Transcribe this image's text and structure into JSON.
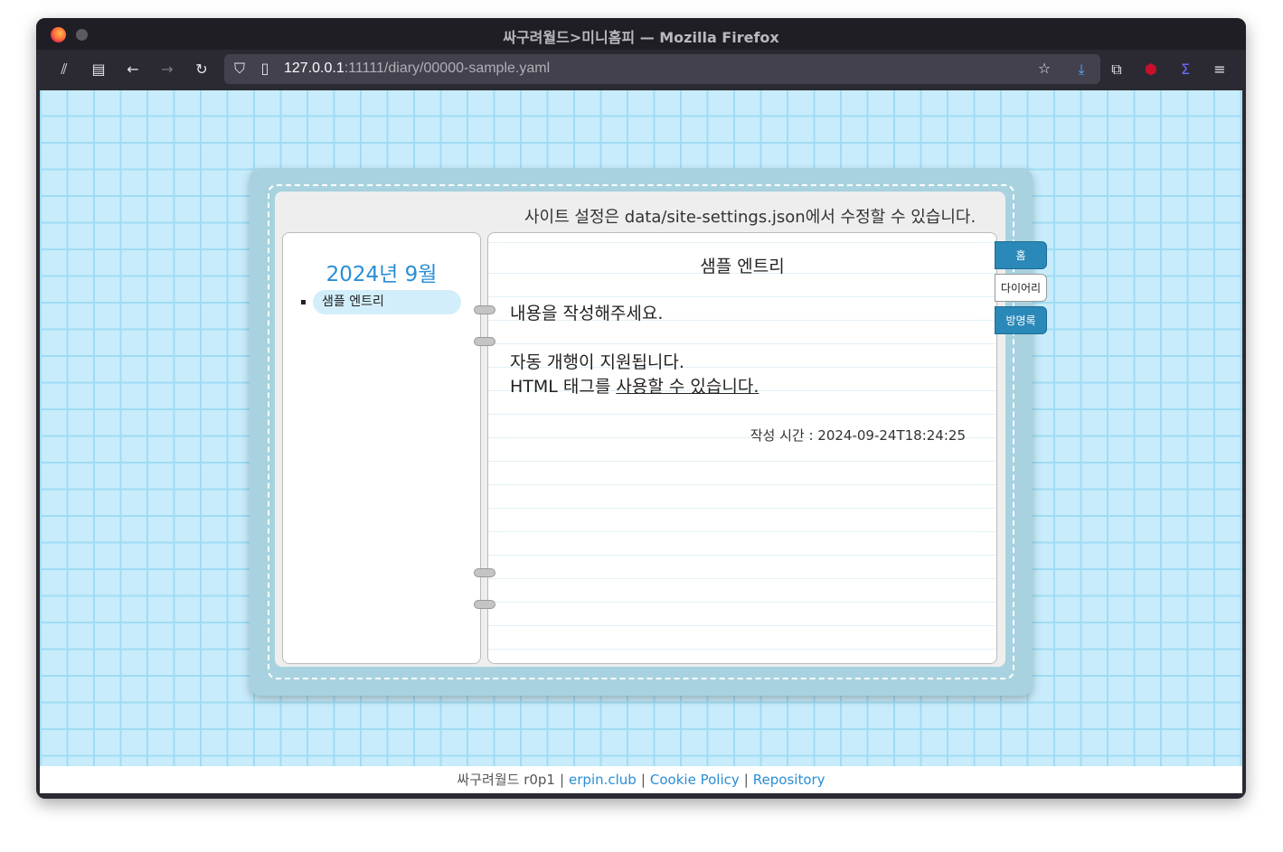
{
  "browser": {
    "window_title": "싸구려월드>미니홈피 — Mozilla Firefox",
    "url_host": "127.0.0.1",
    "url_rest": ":11111/diary/00000-sample.yaml"
  },
  "page": {
    "site_note": "사이트 설정은 data/site-settings.json에서 수정할 수 있습니다.",
    "sidebar": {
      "month": "2024년 9월",
      "entries": [
        "샘플 엔트리"
      ]
    },
    "entry": {
      "title": "샘플 엔트리",
      "line1": "내용을 작성해주세요.",
      "line2": "자동 개행이 지원됩니다.",
      "line3_plain": "HTML 태그를 ",
      "line3_underline": "사용할 수 있습니다.",
      "time": "작성 시간 : 2024-09-24T18:24:25"
    },
    "tabs": [
      "홈",
      "다이어리",
      "방명록"
    ]
  },
  "footer": {
    "brand": "싸구려월드 r0p1",
    "links": [
      "erpin.club",
      "Cookie Policy",
      "Repository"
    ]
  }
}
